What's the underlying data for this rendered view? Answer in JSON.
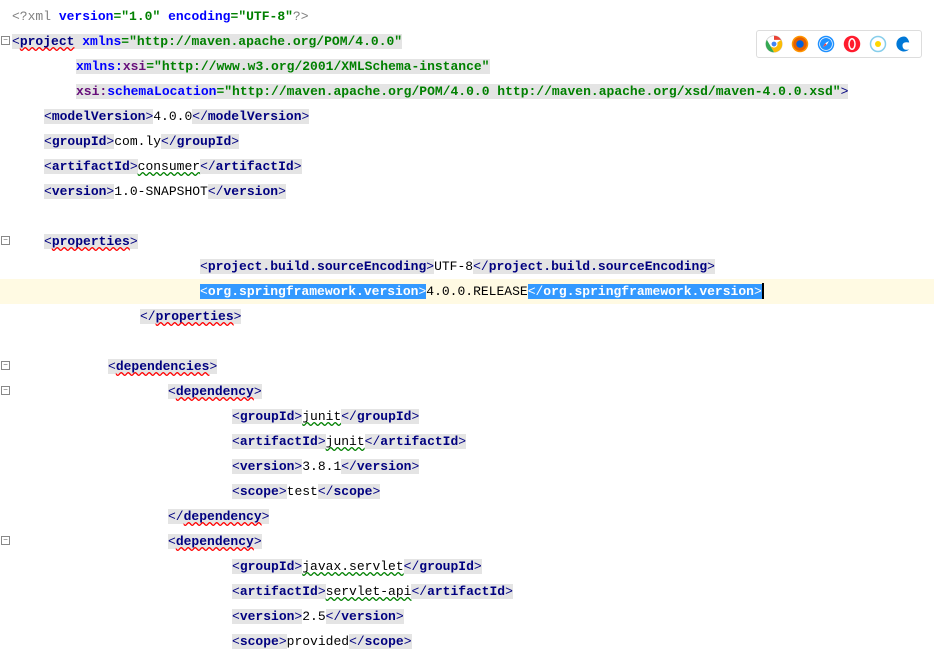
{
  "xml_declaration": {
    "version_attr": "version",
    "version_val": "\"1.0\"",
    "encoding_attr": "encoding",
    "encoding_val": "\"UTF-8\""
  },
  "project": {
    "tag": "project",
    "xmlns_attr": "xmlns",
    "xmlns_val": "\"http://maven.apache.org/POM/4.0.0\"",
    "xsi_ns": "xmlns:",
    "xsi_local": "xsi",
    "xsi_val": "\"http://www.w3.org/2001/XMLSchema-instance\"",
    "schema_ns": "xsi:",
    "schema_local": "schemaLocation",
    "schema_val": "\"http://maven.apache.org/POM/4.0.0 http://maven.apache.org/xsd/maven-4.0.0.xsd\""
  },
  "modelVersion": {
    "tag": "modelVersion",
    "value": "4.0.0"
  },
  "groupId": {
    "tag": "groupId",
    "value": "com.ly"
  },
  "artifactId": {
    "tag": "artifactId",
    "value": "consumer"
  },
  "version": {
    "tag": "version",
    "value": "1.0-SNAPSHOT"
  },
  "properties": {
    "tag": "properties",
    "sourceEncoding": {
      "tag": "project.build.sourceEncoding",
      "value": "UTF-8"
    },
    "springVersion": {
      "tag": "org.springframework.version",
      "value": "4.0.0.RELEASE"
    }
  },
  "dependencies": {
    "tag": "dependencies",
    "dep_tag": "dependency",
    "groupId_tag": "groupId",
    "artifactId_tag": "artifactId",
    "version_tag": "version",
    "scope_tag": "scope",
    "items": [
      {
        "groupId": "junit",
        "artifactId": "junit",
        "version": "3.8.1",
        "scope": "test"
      },
      {
        "groupId": "javax.servlet",
        "artifactId": "servlet-api",
        "version": "2.5",
        "scope": "provided"
      }
    ]
  }
}
